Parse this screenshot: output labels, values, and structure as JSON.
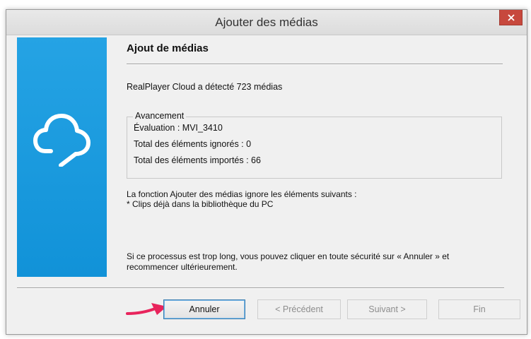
{
  "window": {
    "title": "Ajouter des médias"
  },
  "page": {
    "title": "Ajout de médias",
    "detected": "RealPlayer Cloud a détecté 723 médias"
  },
  "progress": {
    "legend": "Avancement",
    "evaluation": "Évaluation :  MVI_3410",
    "ignored": "Total des éléments ignorés : 0",
    "imported": "Total des éléments importés : 66"
  },
  "info": {
    "line1": "La fonction Ajouter des médias ignore les éléments suivants :",
    "line2": "* Clips déjà dans la bibliothèque du PC"
  },
  "notice": {
    "line1": "Si ce processus est trop long, vous pouvez cliquer en toute sécurité sur « Annuler » et",
    "line2": "recommencer ultérieurement."
  },
  "buttons": {
    "cancel": "Annuler",
    "previous": "< Précédent",
    "next": "Suivant >",
    "finish": "Fin"
  },
  "colors": {
    "side_panel": "#1a9be0",
    "close_button": "#c7483d",
    "arrow": "#e8245c"
  },
  "icons": {
    "side_panel": "cloud-icon",
    "close": "close-icon",
    "pointer": "arrow-icon"
  }
}
